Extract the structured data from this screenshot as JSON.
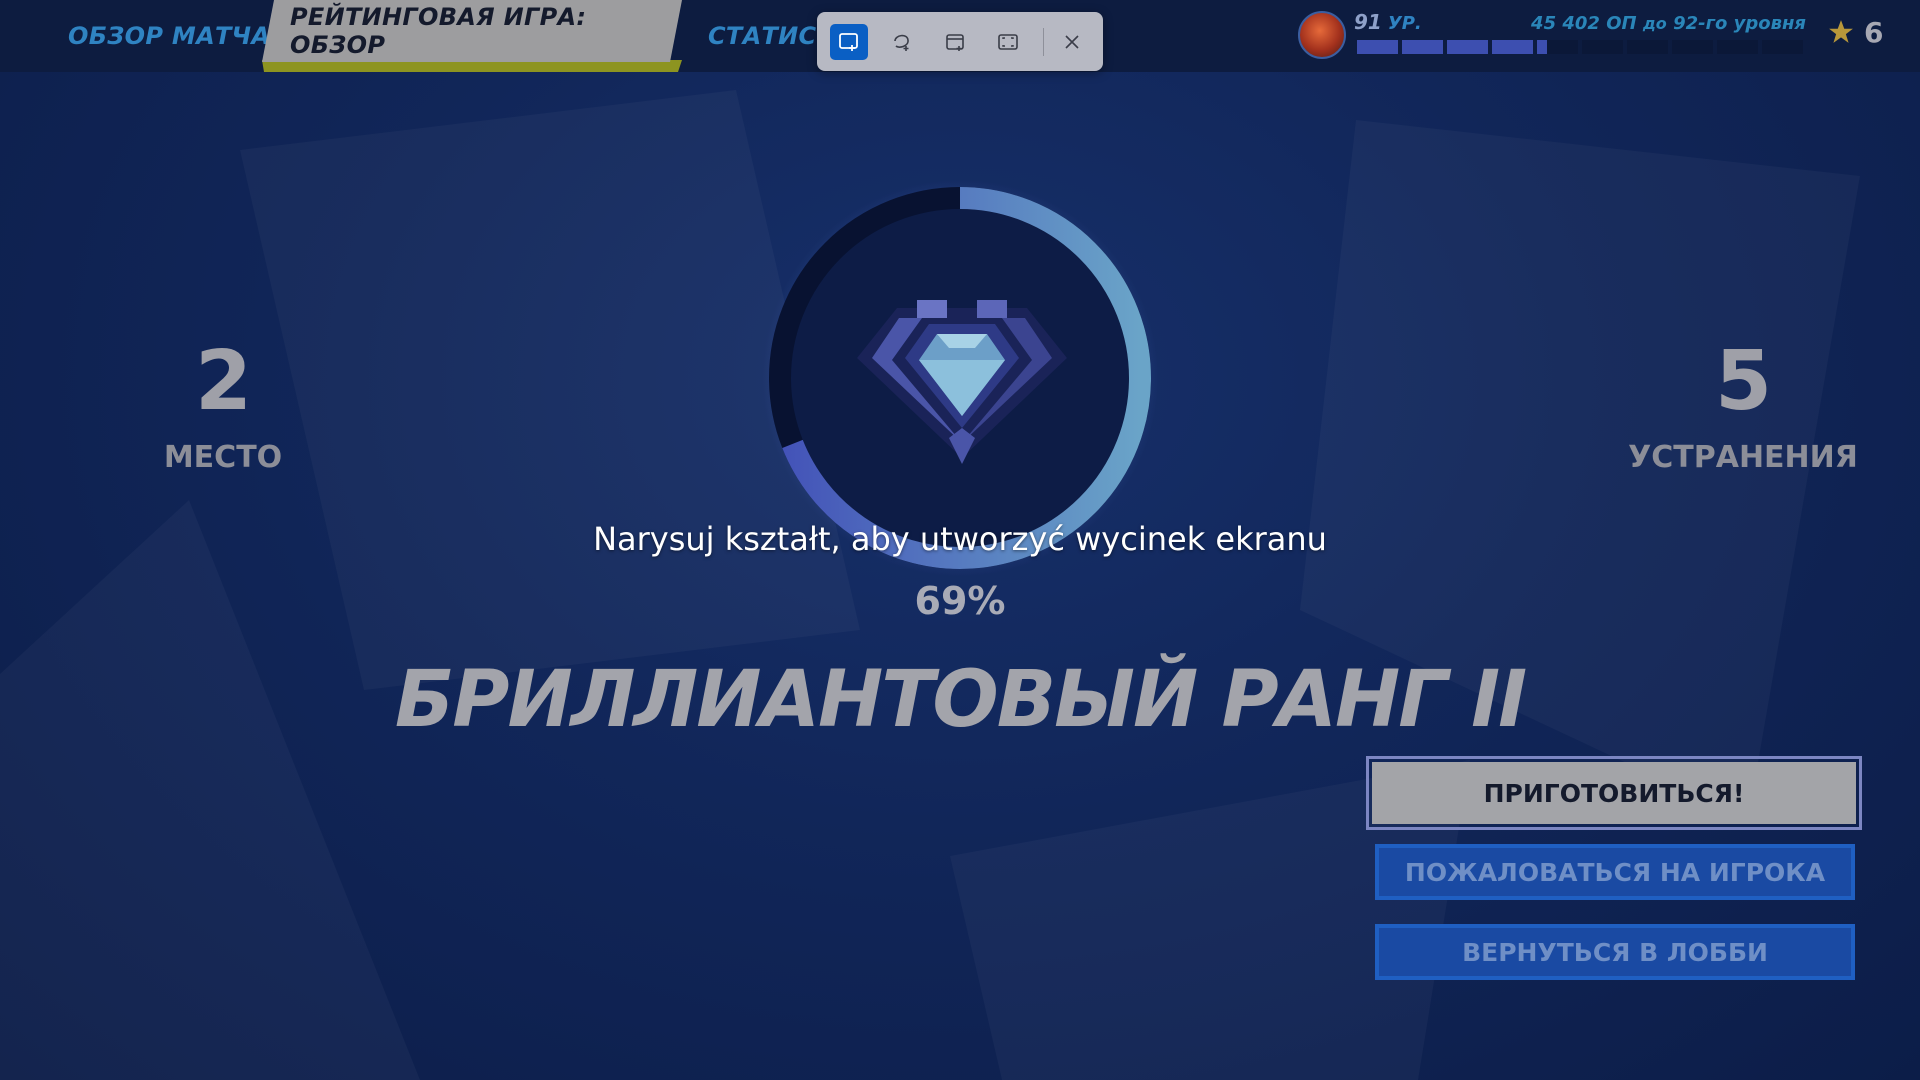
{
  "tabs": {
    "match_overview": "ОБЗОР МАТЧА",
    "ranked_overview": "РЕЙТИНГОВАЯ ИГРА: ОБЗОР",
    "stats": "СТАТИСТ"
  },
  "snip_toolbar": {
    "modes": [
      {
        "icon": "rectangle-snip-icon",
        "active": true
      },
      {
        "icon": "freeform-snip-icon",
        "active": false
      },
      {
        "icon": "window-snip-icon",
        "active": false
      },
      {
        "icon": "fullscreen-snip-icon",
        "active": false
      }
    ],
    "close_icon": "close-icon",
    "instruction": "Narysuj kształt, aby utworzyć wycinek ekranu"
  },
  "player": {
    "level": "91",
    "level_unit": "УР.",
    "xp_amount": "45 402 ОП",
    "xp_to": "до",
    "next_level": "92-го уровня",
    "xp_progress_segments_filled": 4.25,
    "xp_segments_total": 10,
    "stars": "6"
  },
  "match": {
    "place_value": "2",
    "place_label": "МЕСТО",
    "eliminations_value": "5",
    "eliminations_label": "УСТРАНЕНИЯ"
  },
  "rank": {
    "progress_percent_text": "69%",
    "progress": 0.69,
    "title": "БРИЛЛИАНТОВЫЙ РАНГ II"
  },
  "buttons": {
    "ready": "ПРИГОТОВИТЬСЯ!",
    "report": "ПОЖАЛОВАТЬСЯ НА ИГРОКА",
    "lobby": "ВЕРНУТЬСЯ В ЛОББИ"
  },
  "colors": {
    "background": "#112659",
    "accent_blue": "#2f83c2",
    "ring_start": "#4352b8",
    "ring_end": "#6aa4c8",
    "active_tab_underline": "#8d9420"
  }
}
